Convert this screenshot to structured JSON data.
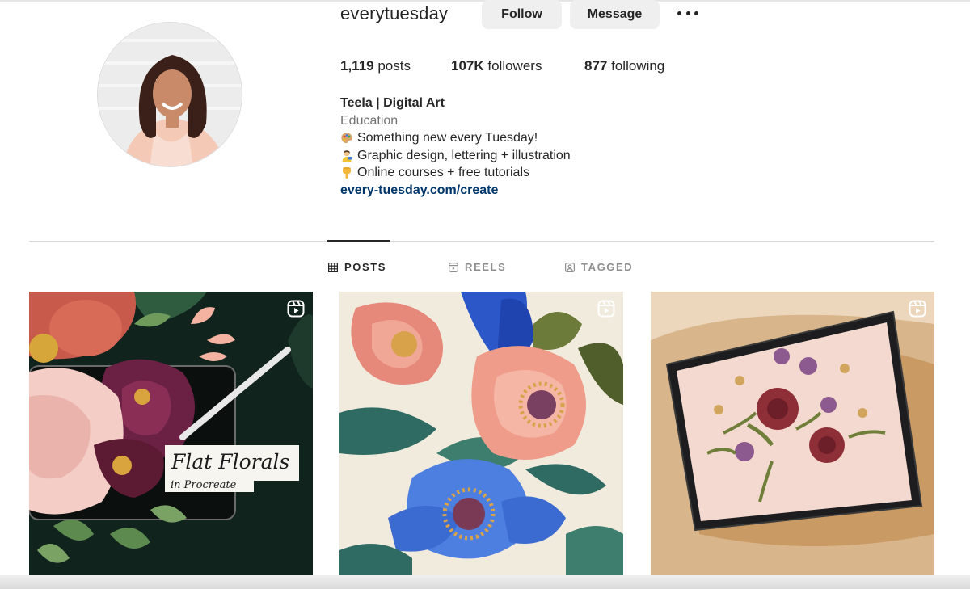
{
  "profile": {
    "username": "everytuesday",
    "follow_label": "Follow",
    "message_label": "Message",
    "more_icon": "more-horizontal-icon",
    "stats": {
      "posts_count": "1,119",
      "posts_label": "posts",
      "followers_count": "107K",
      "followers_label": "followers",
      "following_count": "877",
      "following_label": "following"
    },
    "bio": {
      "name": "Teela | Digital Art",
      "category": "Education",
      "lines": [
        {
          "icon": "artist-palette-icon",
          "text": "Something new every Tuesday!"
        },
        {
          "icon": "artist-emoji-icon",
          "text": "Graphic design, lettering + illustration"
        },
        {
          "icon": "pointing-down-icon",
          "text": "Online courses + free tutorials"
        }
      ],
      "link": "every-tuesday.com/create"
    }
  },
  "tabs": [
    {
      "label": "POSTS",
      "icon": "grid-icon",
      "active": true
    },
    {
      "label": "REELS",
      "icon": "reels-icon",
      "active": false
    },
    {
      "label": "TAGGED",
      "icon": "tagged-icon",
      "active": false
    }
  ],
  "posts": [
    {
      "title": "Flat Florals",
      "subtitle": "in Procreate",
      "icon": "reel-icon"
    },
    {
      "icon": "reel-icon"
    },
    {
      "icon": "reel-icon"
    }
  ],
  "colors": {
    "text": "#262626",
    "muted": "#737373",
    "link": "#00376b",
    "button_bg": "#efefef",
    "divider": "#dbdbdb"
  }
}
